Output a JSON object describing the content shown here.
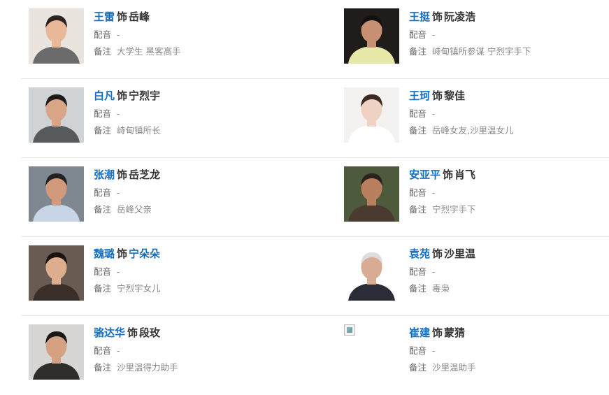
{
  "labels": {
    "shi": "饰",
    "dub": "配音",
    "note": "备注"
  },
  "cast": [
    {
      "actor": "王雷",
      "role": "岳峰",
      "role_is_link": false,
      "dub": "-",
      "note": "大学生 黑客高手",
      "photo_icon": "actor-photo-icon",
      "bg": "#e9e4de",
      "skin": "#e8b898",
      "hair": "#2b2420",
      "shirt": "#6b6b6b"
    },
    {
      "actor": "王挺",
      "role": "阮凌浩",
      "role_is_link": false,
      "dub": "-",
      "note": "峙甸镇所参谋 宁烈宇手下",
      "photo_icon": "actor-photo-icon",
      "bg": "#1f1c1a",
      "skin": "#c79073",
      "hair": "#151312",
      "shirt": "#e6e8a8"
    },
    {
      "actor": "白凡",
      "role": "宁烈宇",
      "role_is_link": false,
      "dub": "-",
      "note": "峙甸镇所长",
      "photo_icon": "actor-photo-icon",
      "bg": "#cfd3d6",
      "skin": "#d8a586",
      "hair": "#1e1c1b",
      "shirt": "#575a5c"
    },
    {
      "actor": "王珂",
      "role": "黎佳",
      "role_is_link": false,
      "dub": "-",
      "note": "岳峰女友,沙里温女儿",
      "photo_icon": "actor-photo-icon",
      "bg": "#f3f2f1",
      "skin": "#efd2c2",
      "hair": "#3a2a22",
      "shirt": "#ffffff"
    },
    {
      "actor": "张潮",
      "role": "岳芝龙",
      "role_is_link": false,
      "dub": "-",
      "note": "岳峰父亲",
      "photo_icon": "actor-photo-icon",
      "bg": "#7f8791",
      "skin": "#d29a7c",
      "hair": "#222",
      "shirt": "#c7d6e6"
    },
    {
      "actor": "安亚平",
      "role": "肖飞",
      "role_is_link": false,
      "dub": "-",
      "note": "宁烈宇手下",
      "photo_icon": "actor-photo-icon",
      "bg": "#4d5a3c",
      "skin": "#b98060",
      "hair": "#2a221d",
      "shirt": "#4a3a30"
    },
    {
      "actor": "魏璐",
      "role": "宁朵朵",
      "role_is_link": true,
      "dub": "-",
      "note": "宁烈宇女儿",
      "photo_icon": "actor-photo-icon",
      "bg": "#6a5b52",
      "skin": "#dcae8e",
      "hair": "#1a1410",
      "shirt": "#3a2e28"
    },
    {
      "actor": "袁苑",
      "role": "沙里温",
      "role_is_link": false,
      "dub": "-",
      "note": "毒枭",
      "photo_icon": "actor-photo-icon",
      "bg": "#ffffff",
      "skin": "#d7ac93",
      "hair": "#dcdcdc",
      "shirt": "#2a2d38"
    },
    {
      "actor": "骆达华",
      "role": "段玫",
      "role_is_link": false,
      "dub": "-",
      "note": "沙里温得力助手",
      "photo_icon": "actor-photo-icon",
      "bg": "#d8d6d4",
      "skin": "#d4a283",
      "hair": "#1b1715",
      "shirt": "#2e2d2c"
    },
    {
      "actor": "崔建",
      "role": "蒙猜",
      "role_is_link": false,
      "dub": "-",
      "note": "沙里温助手",
      "photo_icon": "broken-image-icon",
      "bg": "",
      "skin": "",
      "hair": "",
      "shirt": ""
    }
  ]
}
